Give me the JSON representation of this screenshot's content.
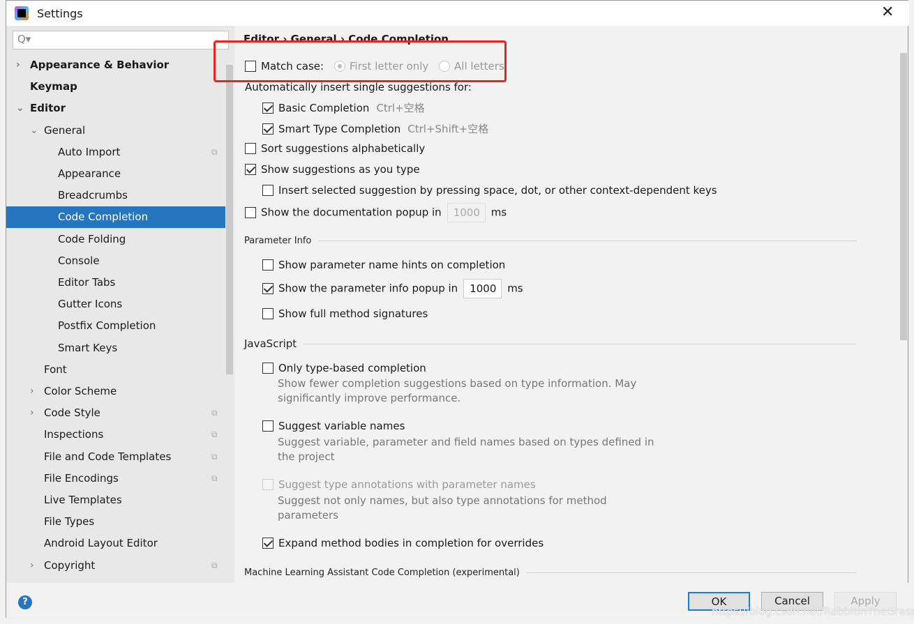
{
  "window": {
    "title": "Settings",
    "close": "✕"
  },
  "search": {
    "icon": "Q▾"
  },
  "tree": [
    {
      "label": "Appearance & Behavior",
      "level": 0,
      "bold": true,
      "arrow": "›"
    },
    {
      "label": "Keymap",
      "level": 0,
      "bold": true
    },
    {
      "label": "Editor",
      "level": 0,
      "bold": true,
      "arrow": "⌄"
    },
    {
      "label": "General",
      "level": 1,
      "arrow": "⌄"
    },
    {
      "label": "Auto Import",
      "level": 2,
      "copy": true
    },
    {
      "label": "Appearance",
      "level": 2
    },
    {
      "label": "Breadcrumbs",
      "level": 2
    },
    {
      "label": "Code Completion",
      "level": 2,
      "selected": true
    },
    {
      "label": "Code Folding",
      "level": 2
    },
    {
      "label": "Console",
      "level": 2
    },
    {
      "label": "Editor Tabs",
      "level": 2
    },
    {
      "label": "Gutter Icons",
      "level": 2
    },
    {
      "label": "Postfix Completion",
      "level": 2
    },
    {
      "label": "Smart Keys",
      "level": 2
    },
    {
      "label": "Font",
      "level": 1
    },
    {
      "label": "Color Scheme",
      "level": 1,
      "arrow": "›"
    },
    {
      "label": "Code Style",
      "level": 1,
      "arrow": "›",
      "copy": true
    },
    {
      "label": "Inspections",
      "level": 1,
      "copy": true
    },
    {
      "label": "File and Code Templates",
      "level": 1,
      "copy": true
    },
    {
      "label": "File Encodings",
      "level": 1,
      "copy": true
    },
    {
      "label": "Live Templates",
      "level": 1
    },
    {
      "label": "File Types",
      "level": 1
    },
    {
      "label": "Android Layout Editor",
      "level": 1
    },
    {
      "label": "Copyright",
      "level": 1,
      "arrow": "›",
      "copy": true
    }
  ],
  "breadcrumb": "Editor  ›  General  ›  Code Completion",
  "content": {
    "match_case": "Match case:",
    "first_letter": "First letter only",
    "all_letters": "All letters",
    "auto_insert": "Automatically insert single suggestions for:",
    "basic": "Basic Completion",
    "basic_sc": "Ctrl+空格",
    "smart": "Smart Type Completion",
    "smart_sc": "Ctrl+Shift+空格",
    "sort": "Sort suggestions alphabetically",
    "show_as_type": "Show suggestions as you type",
    "insert_selected": "Insert selected suggestion by pressing space, dot, or other context-dependent keys",
    "doc_popup": "Show the documentation popup in",
    "doc_ms": "1000",
    "ms": "ms",
    "param_info": "Parameter Info",
    "param_hints": "Show parameter name hints on completion",
    "param_popup": "Show the parameter info popup in",
    "param_ms": "1000",
    "full_sig": "Show full method signatures",
    "javascript": "JavaScript",
    "type_based": "Only type-based completion",
    "type_based_desc": "Show fewer completion suggestions based on type information. May significantly improve performance.",
    "suggest_var": "Suggest variable names",
    "suggest_var_desc": "Suggest variable, parameter and field names based on types defined in the project",
    "suggest_type": "Suggest type annotations with parameter names",
    "suggest_type_desc": "Suggest not only names, but also type annotations for method parameters",
    "expand": "Expand method bodies in completion for overrides",
    "ml": "Machine Learning Assistant Code Completion (experimental)"
  },
  "buttons": {
    "ok": "OK",
    "cancel": "Cancel",
    "apply": "Apply",
    "help": "?"
  },
  "watermark": "https://blog.csdn.net/RabbitInTheGrass",
  "colors": {
    "selection": "#2675bf",
    "highlight_box": "#e8251e"
  }
}
